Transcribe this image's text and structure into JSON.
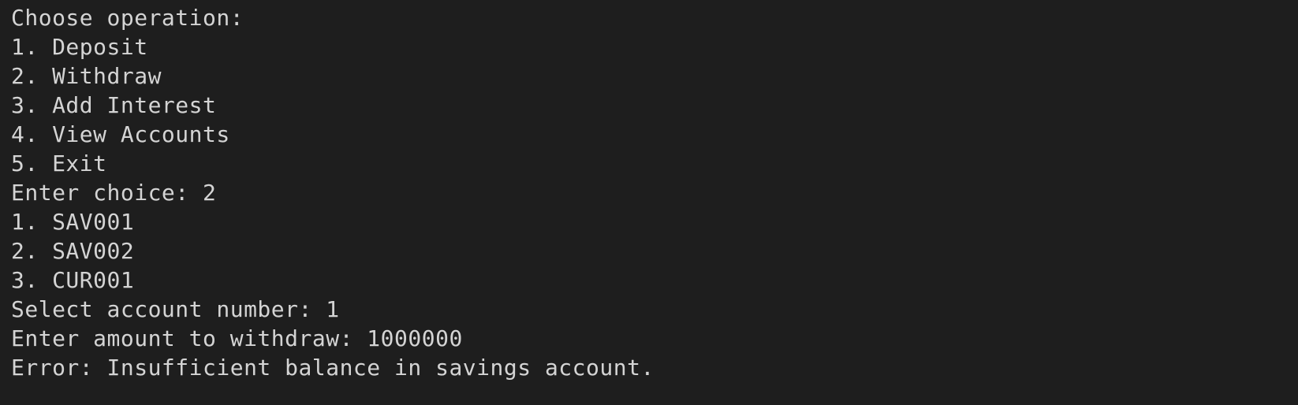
{
  "terminal": {
    "lines": [
      "Choose operation:",
      "1. Deposit",
      "2. Withdraw",
      "3. Add Interest",
      "4. View Accounts",
      "5. Exit",
      "Enter choice: 2",
      "1. SAV001",
      "2. SAV002",
      "3. CUR001",
      "Select account number: 1",
      "Enter amount to withdraw: 1000000",
      "Error: Insufficient balance in savings account."
    ]
  },
  "colors": {
    "background": "#1e1e1e",
    "text": "#d4d4d4"
  }
}
